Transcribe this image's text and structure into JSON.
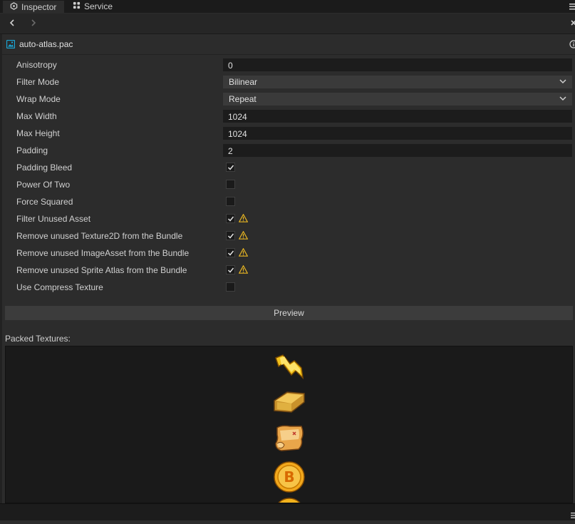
{
  "tabs": [
    {
      "label": "Inspector",
      "icon": "inspector-icon",
      "active": true
    },
    {
      "label": "Service",
      "icon": "service-icon",
      "active": false
    }
  ],
  "asset": {
    "title": "auto-atlas.pac",
    "icon": "image-asset-icon"
  },
  "properties": [
    {
      "label": "Anisotropy",
      "type": "input",
      "value": "0"
    },
    {
      "label": "Filter Mode",
      "type": "select",
      "value": "Bilinear"
    },
    {
      "label": "Wrap Mode",
      "type": "select",
      "value": "Repeat"
    },
    {
      "label": "Max Width",
      "type": "input",
      "value": "1024"
    },
    {
      "label": "Max Height",
      "type": "input",
      "value": "1024"
    },
    {
      "label": "Padding",
      "type": "input",
      "value": "2"
    },
    {
      "label": "Padding Bleed",
      "type": "checkbox",
      "checked": true,
      "warning": false
    },
    {
      "label": "Power Of Two",
      "type": "checkbox",
      "checked": false,
      "warning": false
    },
    {
      "label": "Force Squared",
      "type": "checkbox",
      "checked": false,
      "warning": false
    },
    {
      "label": "Filter Unused Asset",
      "type": "checkbox",
      "checked": true,
      "warning": true
    },
    {
      "label": "Remove unused Texture2D from the Bundle",
      "type": "checkbox",
      "checked": true,
      "warning": true
    },
    {
      "label": "Remove unused ImageAsset from the Bundle",
      "type": "checkbox",
      "checked": true,
      "warning": true
    },
    {
      "label": "Remove unused Sprite Atlas from the Bundle",
      "type": "checkbox",
      "checked": true,
      "warning": true
    },
    {
      "label": "Use Compress Texture",
      "type": "checkbox",
      "checked": false,
      "warning": false
    }
  ],
  "preview_button": "Preview",
  "packed": {
    "label": "Packed Textures:",
    "sprites": [
      "lightning-sprite",
      "gold-bar-sprite",
      "scroll-map-sprite",
      "bitcoin-coin-sprite",
      "coin-sprite"
    ]
  },
  "colors": {
    "accent": "#1aa8d8",
    "warning": "#e6b422",
    "gold": "#f2b21c"
  }
}
